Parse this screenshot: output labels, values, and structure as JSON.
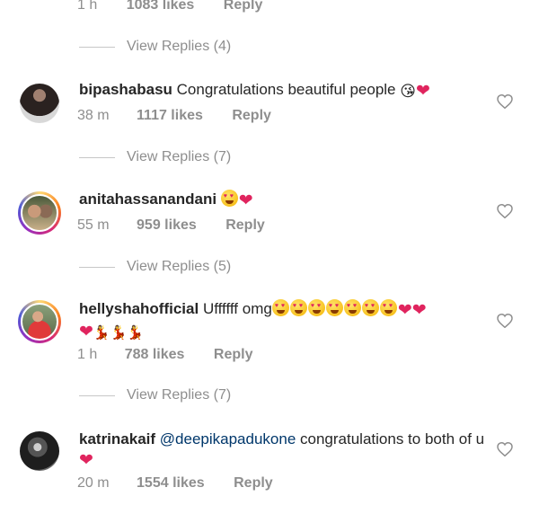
{
  "top_partial": {
    "time": "1 h",
    "likes": "1083 likes",
    "reply": "Reply"
  },
  "view_replies": [
    "View Replies (4)",
    "View Replies (7)",
    "View Replies (5)",
    "View Replies (7)"
  ],
  "comments": [
    {
      "username": "bipashabasu",
      "text": "Congratulations beautiful people",
      "emoji": "😘❤",
      "time": "38 m",
      "likes": "1117 likes",
      "reply": "Reply"
    },
    {
      "username": "anitahassanandani",
      "text": "",
      "emoji": "😍❤",
      "time": "55 m",
      "likes": "959 likes",
      "reply": "Reply"
    },
    {
      "username": "hellyshahofficial",
      "text": "Uffffff omg",
      "emoji": "😍😍😍😍😍😍😍❤❤ ❤💃💃💃",
      "time": "1 h",
      "likes": "788 likes",
      "reply": "Reply"
    },
    {
      "username": "katrinakaif",
      "mention": "@deepikapadukone",
      "text": "congratulations to both of u",
      "emoji": "❤",
      "time": "20 m",
      "likes": "1554 likes",
      "reply": "Reply"
    }
  ],
  "colors": {
    "accent_heart": "#e0245e",
    "meta_gray": "#8e8e8e",
    "mention_blue": "#00376b"
  }
}
